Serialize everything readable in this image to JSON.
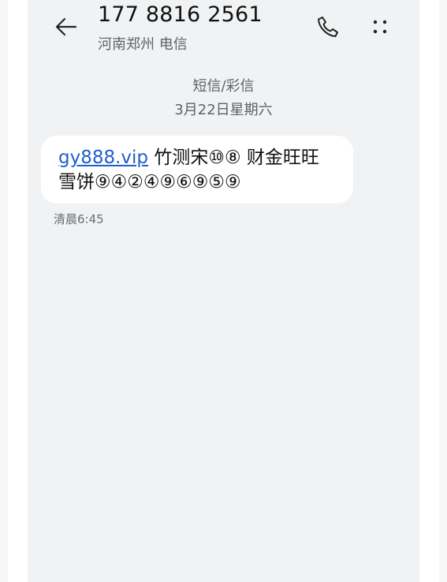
{
  "header": {
    "title": "177 8816 2561",
    "subtitle": "河南郑州 电信"
  },
  "conversation": {
    "type_label": "短信/彩信",
    "date_label": "3月22日星期六",
    "messages": [
      {
        "link": "gy888.vip",
        "text_line1": " 竹测宋⑩⑧ 财金旺旺",
        "text_line2": "雪饼⑨④②④⑨⑥⑨⑤⑨",
        "time": "清晨6:45"
      }
    ]
  },
  "icons": {
    "back": "arrow-left-icon",
    "call": "phone-icon",
    "more": "more-dots-icon"
  }
}
